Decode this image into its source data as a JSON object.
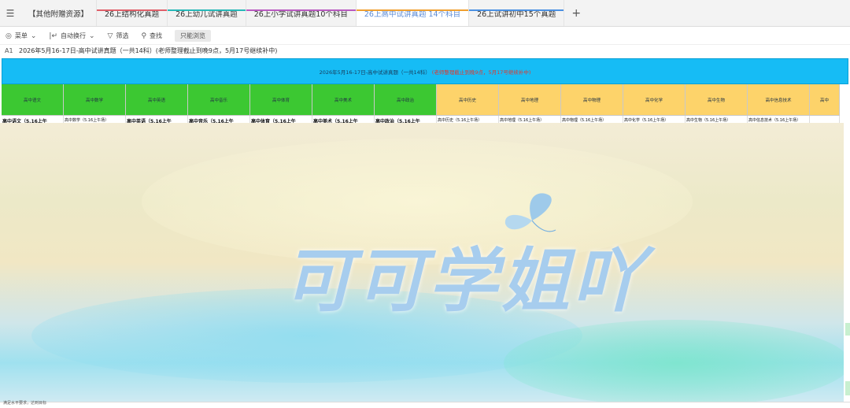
{
  "tabs": {
    "menu_icon": "layers-icon",
    "items": [
      {
        "label": "【其他附赠资源】",
        "color": "",
        "active": false
      },
      {
        "label": "26上结构化真题",
        "color": "#e0606a",
        "active": false
      },
      {
        "label": "26上幼儿试讲真题",
        "color": "#28b8b8",
        "active": false
      },
      {
        "label": "26上小学试讲真题10个科目",
        "color": "#b95ac0",
        "active": false
      },
      {
        "label": "26上高中试讲真题 14个科目",
        "color": "#f0a030",
        "active": true
      },
      {
        "label": "26上试讲初中15个真题",
        "color": "#4a90e2",
        "active": false
      }
    ],
    "add_label": "+"
  },
  "toolbar": {
    "menu_label": "菜单",
    "wrap_label": "自动换行",
    "filter_label": "筛选",
    "find_label": "查找",
    "readonly_label": "只能浏览"
  },
  "formula_bar": {
    "cell_ref": "A1",
    "content": "2026年5月16-17日-高中试讲真题（一共14科）(老师整理截止到晚9点，5月17号继续补中)"
  },
  "sheet": {
    "header_title": "2026年5月16-17日-高中试讲真题（一共14科）",
    "header_note": "(老师整理截止到晚9点，5月17号继续补中)",
    "subjects": [
      {
        "label": "高中语文",
        "color": "#3cc832"
      },
      {
        "label": "高中数学",
        "color": "#3cc832"
      },
      {
        "label": "高中英语",
        "color": "#3cc832"
      },
      {
        "label": "高中音乐",
        "color": "#3cc832"
      },
      {
        "label": "高中体育",
        "color": "#3cc832"
      },
      {
        "label": "高中美术",
        "color": "#3cc832"
      },
      {
        "label": "高中政治",
        "color": "#3cc832"
      },
      {
        "label": "高中历史",
        "color": "#fdd36a"
      },
      {
        "label": "高中地理",
        "color": "#fdd36a"
      },
      {
        "label": "高中物理",
        "color": "#fdd36a"
      },
      {
        "label": "高中化学",
        "color": "#fdd36a"
      },
      {
        "label": "高中生物",
        "color": "#fdd36a"
      },
      {
        "label": "高中信息技术",
        "color": "#fdd36a"
      },
      {
        "label": "高中",
        "color": "#fdd36a"
      }
    ],
    "first_row": [
      "高中语文（5.16上午",
      "高中数学（5.16上午场）",
      "高中英语（5.16上午",
      "高中音乐（5.16上午",
      "高中体育（5.16上午",
      "高中美术（5.16上午",
      "高中政治（5.16上午",
      "高中历史（5.16上午场）",
      "高中地理（5.16上午场）",
      "高中物理（5.16上午场）",
      "高中化学（5.16上午场）",
      "高中生物（5.16上午场）",
      "高中信息技术（5.16上午场）",
      ""
    ],
    "bottom_text": "满足水平要求，达到目标"
  },
  "watermark": {
    "text": "可可学姐吖",
    "icon": "butterfly-icon"
  }
}
